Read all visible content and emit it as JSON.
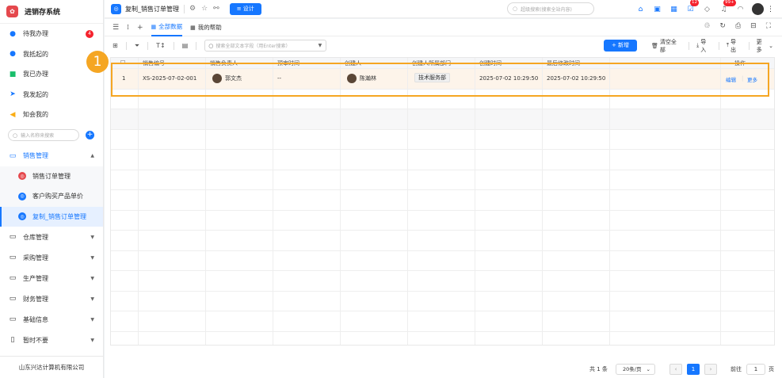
{
  "brand": {
    "name": "进销存系统",
    "logo_icon": "app-logo-icon"
  },
  "sidebar": {
    "quick": [
      {
        "label": "待我办理",
        "badge": "4",
        "icon": "user-icon",
        "color": "#1677ff"
      },
      {
        "label": "我抵起的",
        "icon": "user-add-icon",
        "color": "#1677ff"
      },
      {
        "label": "我已办理",
        "icon": "check-doc-icon",
        "color": "#19be6b"
      },
      {
        "label": "我发起的",
        "icon": "send-icon",
        "color": "#1677ff"
      },
      {
        "label": "知会我的",
        "icon": "megaphone-icon",
        "color": "#faad14"
      }
    ],
    "search_placeholder": "输入名称来搜索",
    "groups": [
      {
        "label": "销售管理",
        "open": true,
        "children": [
          {
            "label": "销售订单管理",
            "color": "#e5484d"
          },
          {
            "label": "客户购买产品单价",
            "color": "#1677ff"
          },
          {
            "label": "复制_销售订单管理",
            "color": "#1677ff",
            "active": true
          }
        ]
      },
      {
        "label": "仓库管理"
      },
      {
        "label": "采购管理"
      },
      {
        "label": "生产管理"
      },
      {
        "label": "财务管理"
      },
      {
        "label": "基础信息"
      },
      {
        "label": "暂时不要"
      }
    ],
    "company": "山东兴达计算机有限公司"
  },
  "header": {
    "app_title": "复制_销售订单管理",
    "design_label": "设计",
    "search_placeholder": "超级搜索(搜索全站内容)",
    "badge_messages": "12",
    "badge_notifications": "99+"
  },
  "tabs": {
    "all_data": "全部数据",
    "my_help": "我的帮助"
  },
  "toolbar": {
    "search_placeholder": "搜索全部文本字段（用Enter搜索）",
    "add_label": "新增",
    "clear_label": "清空全部",
    "import_label": "导入",
    "export_label": "导出",
    "more_label": "更多"
  },
  "table": {
    "columns": [
      "销售编号",
      "销售负责人",
      "预审时间",
      "创建人",
      "创建人所属部门",
      "创建时间",
      "最后修改时间",
      "操作"
    ],
    "rows": [
      {
        "index": "1",
        "order_no": "XS-2025-07-02-001",
        "owner": "郭文杰",
        "review_time": "--",
        "creator": "陈瀚林",
        "department": "技术服务部",
        "created_at": "2025-07-02 10:29:50",
        "updated_at": "2025-07-02 10:29:50",
        "action_edit": "编辑",
        "action_more": "更多"
      }
    ]
  },
  "annotation": {
    "marker": "1",
    "color": "#f5a623"
  },
  "pagination": {
    "total": "共 1 条",
    "page_size": "20条/页",
    "current_page": "1",
    "goto_label": "前往",
    "goto_value": "1",
    "goto_suffix": "页"
  }
}
